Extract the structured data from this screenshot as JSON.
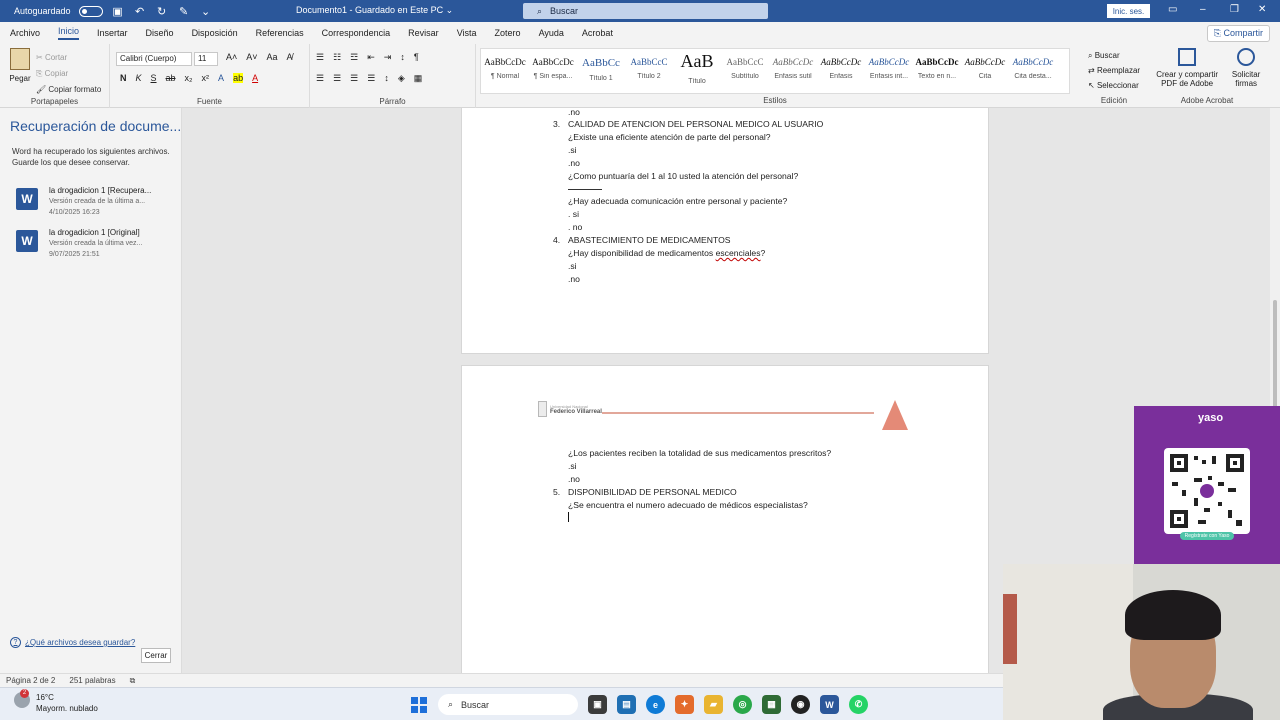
{
  "titlebar": {
    "autosave_label": "Autoguardado",
    "doc_title": "Documento1 - Guardado en Este PC",
    "doc_title_chevron": "⌄",
    "search_placeholder": "Buscar",
    "signin_label": "Inic. ses."
  },
  "tabs": [
    "Archivo",
    "Inicio",
    "Insertar",
    "Diseño",
    "Disposición",
    "Referencias",
    "Correspondencia",
    "Revisar",
    "Vista",
    "Zotero",
    "Ayuda",
    "Acrobat"
  ],
  "share_label": "Compartir",
  "ribbon": {
    "clipboard": {
      "paste": "Pegar",
      "cut": "Cortar",
      "copy": "Copiar",
      "format_painter": "Copiar formato",
      "group": "Portapapeles"
    },
    "font": {
      "name": "Calibri (Cuerpo)",
      "size": "11",
      "group": "Fuente"
    },
    "paragraph": {
      "group": "Párrafo"
    },
    "styles": {
      "group": "Estilos",
      "items": [
        {
          "sample": "AaBbCcDc",
          "name": "¶ Normal"
        },
        {
          "sample": "AaBbCcDc",
          "name": "¶ Sin espa..."
        },
        {
          "sample": "AaBbCc",
          "name": "Título 1"
        },
        {
          "sample": "AaBbCcC",
          "name": "Título 2"
        },
        {
          "sample": "AaB",
          "name": "Título"
        },
        {
          "sample": "AaBbCcC",
          "name": "Subtítulo"
        },
        {
          "sample": "AaBbCcDc",
          "name": "Énfasis sutil"
        },
        {
          "sample": "AaBbCcDc",
          "name": "Énfasis"
        },
        {
          "sample": "AaBbCcDc",
          "name": "Énfasis int..."
        },
        {
          "sample": "AaBbCcDc",
          "name": "Texto en n..."
        },
        {
          "sample": "AaBbCcDc",
          "name": "Cita"
        },
        {
          "sample": "AaBbCcDc",
          "name": "Cita desta..."
        }
      ]
    },
    "editing": {
      "find": "Buscar",
      "replace": "Reemplazar",
      "select": "Seleccionar",
      "group": "Edición"
    },
    "adobe": {
      "create": "Crear y compartir PDF de Adobe",
      "request": "Solicitar firmas",
      "group": "Adobe Acrobat"
    }
  },
  "recovery": {
    "title": "Recuperación de docume...",
    "desc": "Word ha recuperado los siguientes archivos. Guarde los que desee conservar.",
    "files": [
      {
        "name": "la drogadicion 1 [Recupera...",
        "version": "Versión creada de la última a...",
        "date": "4/10/2025 16:23"
      },
      {
        "name": "la drogadicion 1 [Original]",
        "version": "Versión creada la última vez...",
        "date": "9/07/2025 21:51"
      }
    ],
    "help_link": "¿Qué archivos desea guardar?",
    "close_label": "Cerrar"
  },
  "document": {
    "page1": [
      ".no",
      "CALIDAD DE ATENCION DEL PERSONAL MEDICO AL USUARIO",
      "¿Existe una eficiente atención de parte del personal?",
      ".si",
      ".no",
      "¿Como puntuaría del 1 al 10 usted la atención del personal?",
      "¿Hay adecuada comunicación entre personal y paciente?",
      ". si",
      ". no",
      "ABASTECIMIENTO DE MEDICAMENTOS",
      "¿Hay disponibilidad de medicamentos",
      "escenciales",
      "?",
      ".si",
      ".no"
    ],
    "page1_numbers": [
      "3.",
      "4."
    ],
    "page2": [
      "¿Los pacientes reciben la totalidad de sus medicamentos prescritos?",
      ".si",
      ".no",
      "DISPONIBILIDAD DE PERSONAL MEDICO",
      "¿Se encuentra el numero adecuado de médicos especialistas?"
    ],
    "page2_numbers": [
      "5."
    ],
    "header_univ": "Universidad Nacional",
    "header_name": "Federico Villarreal"
  },
  "statusbar": {
    "page": "Página 2 de 2",
    "words": "251 palabras"
  },
  "taskbar": {
    "weather_temp": "16°C",
    "weather_desc": "Mayorm. nublado",
    "weather_badge": "2",
    "search": "Buscar"
  },
  "overlay": {
    "qr_brand": "yaso",
    "qr_caption": "Regístrate con Yaso"
  },
  "colors": {
    "word_blue": "#2b579a",
    "qr_purple": "#7a2f9b",
    "spell_red": "#c00000"
  }
}
